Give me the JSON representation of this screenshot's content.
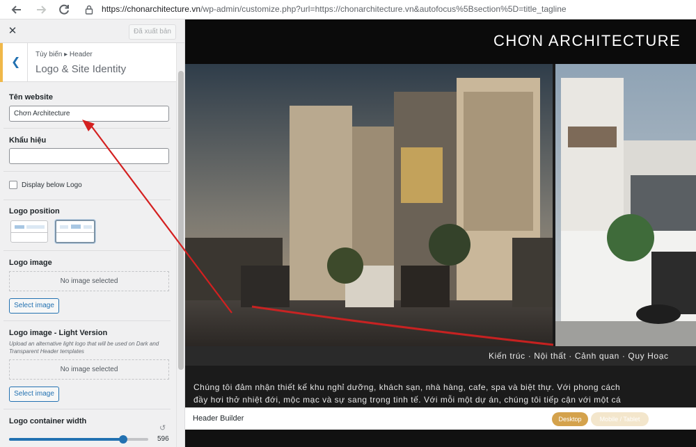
{
  "browser": {
    "url_host": "https://chonarchitecture.vn",
    "url_rest": "/wp-admin/customize.php?url=https://chonarchitecture.vn&autofocus%5Bsection%5D=title_tagline",
    "icons": [
      "back-arrow-icon",
      "forward-arrow-icon",
      "reload-icon",
      "lock-icon"
    ]
  },
  "sidebar": {
    "close_label": "✕",
    "publish_label": "Đã xuất bản",
    "breadcrumb": "Tùy biến ▸ Header",
    "section_title": "Logo & Site Identity",
    "site_name_label": "Tên website",
    "site_name_value": "Chơn Architecture",
    "tagline_label": "Khẩu hiệu",
    "tagline_value": "",
    "display_below_logo": "Display below Logo",
    "logo_position_label": "Logo position",
    "logo_image_label": "Logo image",
    "no_image": "No image selected",
    "select_image": "Select image",
    "logo_light_label": "Logo image - Light Version",
    "logo_light_desc": "Upload an alternative light logo that will be used on Dark and Transparent Header templates",
    "no_image_2": "No image selected",
    "select_image_2": "Select image",
    "container_width_label": "Logo container width",
    "container_width_value": "596",
    "container_width_fraction": 0.82
  },
  "preview": {
    "site_title": "CHƠN ARCHITECTURE",
    "menu_text": "Kiến trúc · Nội thất · Cảnh quan · Quy Hoạc",
    "intro_line1": "Chúng tôi đảm nhận thiết kế khu nghỉ dưỡng, khách sạn, nhà hàng, cafe, spa và biệt thự. Với phong cách",
    "intro_line2": "đầy hơi thở nhiệt đới, mộc mạc và sự sang trọng tinh tế. Với mỗi một dự án, chúng tôi tiếp cận với một cá",
    "header_builder": "Header Builder",
    "desktop": "Desktop",
    "mobile": "Mobile / Tablet"
  },
  "colors": {
    "accent": "#2271b1",
    "section_bar": "#f0b849",
    "arrow": "#d42020",
    "desktop_btn": "#d4a24c"
  }
}
